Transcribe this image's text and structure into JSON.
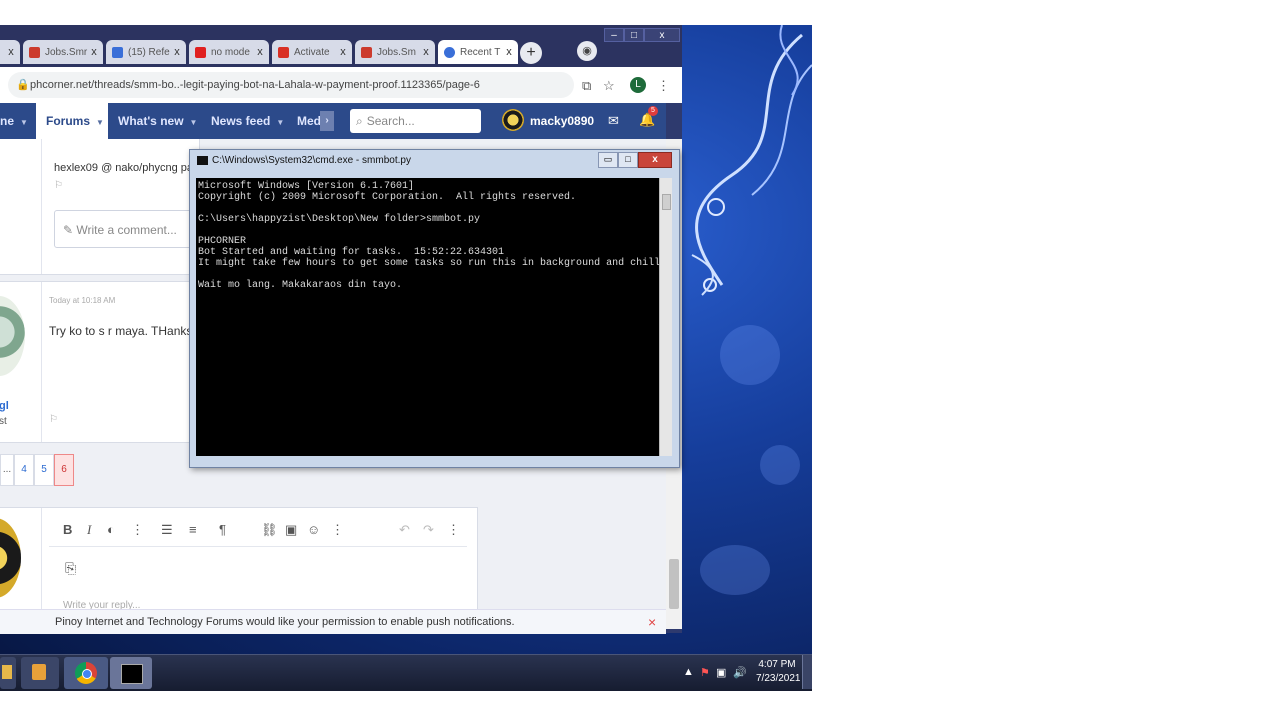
{
  "browser": {
    "tabs": [
      {
        "title": "",
        "favicon_color": "#cc3b2e"
      },
      {
        "title": "Jobs.Smr",
        "favicon_color": "#cc3b2e"
      },
      {
        "title": "(15) Refe",
        "favicon_color": "#3a6fd8"
      },
      {
        "title": "no mode",
        "favicon_color": "#e02020"
      },
      {
        "title": "Activate",
        "favicon_color": "#d93025"
      },
      {
        "title": "Jobs.Sm",
        "favicon_color": "#cc3b2e"
      },
      {
        "title": "Recent T",
        "favicon_color": "#3a6fd8"
      }
    ],
    "new_tab_label": "+",
    "url": "phcorner.net/threads/smm-bo..-legit-paying-bot-na-Lahala-w-payment-proof.1123365/page-6",
    "profile_initial": "L",
    "window_buttons": [
      "–",
      "□",
      "x"
    ]
  },
  "forum_nav": {
    "items": [
      {
        "label": "ne"
      },
      {
        "label": "Forums"
      },
      {
        "label": "What's new"
      },
      {
        "label": "News feed"
      },
      {
        "label": "Med"
      }
    ],
    "search_placeholder": "Search...",
    "username": "macky0890",
    "notification_count": "5"
  },
  "posts": {
    "top_snippet": "hexlex09 @ nako/phycng pasa vmware",
    "comment_placeholder": "Write a comment...",
    "post_time": "Today at 10:18 AM",
    "post_text": "Try ko to s r maya. THanks",
    "author_fragment": "gl",
    "author_role_fragment": "st"
  },
  "pagination": {
    "items": [
      "...",
      "4",
      "5",
      "6"
    ],
    "current": "6"
  },
  "editor": {
    "reply_placeholder": "Write your reply..."
  },
  "push_notice": {
    "text": "Pinoy Internet and Technology Forums would like your permission to enable push notifications.",
    "close_label": "×"
  },
  "cmd": {
    "title": "C:\\Windows\\System32\\cmd.exe - smmbot.py",
    "lines": [
      "Microsoft Windows [Version 6.1.7601]",
      "Copyright (c) 2009 Microsoft Corporation.  All rights reserved.",
      "",
      "C:\\Users\\happyzist\\Desktop\\New folder>smmbot.py",
      "",
      "PHCORNER",
      "Bot Started and waiting for tasks.  15:52:22.634301",
      "It might take few hours to get some tasks so run this in background and chill.",
      "",
      "Wait mo lang. Makakaraos din tayo."
    ]
  },
  "taskbar": {
    "time": "4:07 PM",
    "date": "7/23/2021"
  }
}
